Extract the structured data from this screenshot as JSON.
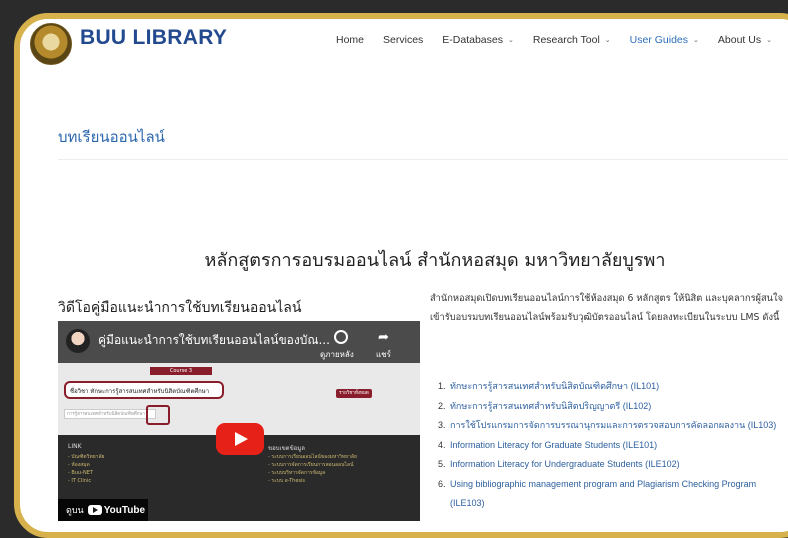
{
  "header": {
    "brand": "BUU LIBRARY",
    "nav": [
      {
        "label": "Home",
        "has_dropdown": false
      },
      {
        "label": "Services",
        "has_dropdown": false
      },
      {
        "label": "E-Databases",
        "has_dropdown": true
      },
      {
        "label": "Research Tool",
        "has_dropdown": true
      },
      {
        "label": "User Guides",
        "has_dropdown": true,
        "active": true
      },
      {
        "label": "About Us",
        "has_dropdown": true
      }
    ],
    "chevron": "⌄"
  },
  "page_title": "บทเรียนออนไลน์",
  "main_heading": "หลักสูตรการอบรมออนไลน์ สำนักหอสมุด มหาวิทยาลัยบูรพา",
  "video_section": {
    "heading": "วิดีโอคู่มือแนะนำการใช้บทเรียนออนไลน์",
    "video": {
      "title": "คู่มือแนะนำการใช้บทเรียนออนไลน์ของบัณ...",
      "watch_later": "ดูภายหลัง",
      "share": "แชร์",
      "slide_course_label": "Course 3",
      "slide_course_title": "ชื่อวิชา ทักษะการรู้สารสนเทศสำหรับนิสิตบัณฑิตศึกษา",
      "slide_button": "รายวิชาทั้งหมด",
      "slide_search": "การรู้สารสนเทศสำหรับนิสิตบัณฑิตศึกษา",
      "link_heading": "LINK",
      "links": [
        "- บัณฑิตวิทยาลัย",
        "- ห้องสมุด",
        "- Buu-NET",
        "- IT Clinic"
      ],
      "info_heading": "ขอบเขตข้อมูล",
      "info_links": [
        "- ระบบการเรียนออนไลน์ของมหาวิทยาลัย",
        "- ระบบการจัดการเรียนการสอนออนไลน์",
        "- ระบบบริหารจัดการข้อมูล",
        "- ระบบ e-Thesis"
      ],
      "watch_on": "ดูบน",
      "youtube": "YouTube"
    }
  },
  "intro_text": "สำนักหอสมุดเปิดบทเรียนออนไลน์การใช้ห้องสมุด 6 หลักสูตร ให้นิสิต และบุคลากรผู้สนใจเข้ารับอบรมบทเรียนออนไลน์พร้อมรับวุฒิบัตรออนไลน์ โดยลงทะเบียนในระบบ LMS ดังนี้",
  "courses": [
    {
      "num": "1.",
      "label": "ทักษะการรู้สารสนเทศสำหรับนิสิตบัณฑิตศึกษา (IL101)"
    },
    {
      "num": "2.",
      "label": "ทักษะการรู้สารสนเทศสำหรับนิสิตปริญญาตรี (IL102)"
    },
    {
      "num": "3.",
      "label": "การใช้โปรแกรมการจัดการบรรณานุกรมและการตรวจสอบการคัดลอกผลงาน (IL103)"
    },
    {
      "num": "4.",
      "label": "Information Literacy for Graduate Students (ILE101)"
    },
    {
      "num": "5.",
      "label": "Information Literacy for Undergraduate Students (ILE102)"
    },
    {
      "num": "6.",
      "label": "Using bibliographic management program and Plagiarism Checking Program (ILE103)"
    }
  ],
  "colors": {
    "frame": "#d7b24c",
    "brand": "#234a8f",
    "link": "#2c5f9e",
    "active_nav": "#2d6fb9"
  }
}
